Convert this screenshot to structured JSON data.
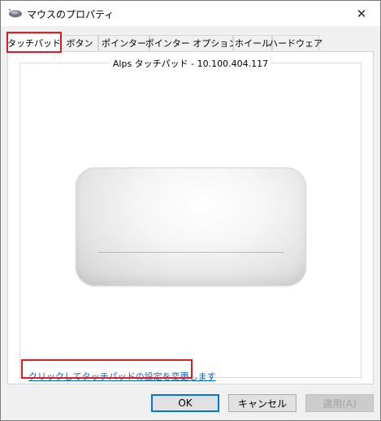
{
  "window": {
    "title": "マウスのプロパティ",
    "close_glyph": "✕"
  },
  "tabs": [
    {
      "label": "タッチパッド",
      "active": true
    },
    {
      "label": "ボタン"
    },
    {
      "label": "ポインター"
    },
    {
      "label": "ポインター オプション"
    },
    {
      "label": "ホイール"
    },
    {
      "label": "ハードウェア"
    }
  ],
  "panel": {
    "group_label": "Alps タッチパッド - 10.100.404.117",
    "link_text": "クリックしてタッチパッドの設定を変更します"
  },
  "buttons": {
    "ok": "OK",
    "cancel": "キャンセル",
    "apply": "適用(A)"
  },
  "colors": {
    "highlight": "#e01b24",
    "link": "#0066cc",
    "default_button_border": "#0078d7"
  }
}
